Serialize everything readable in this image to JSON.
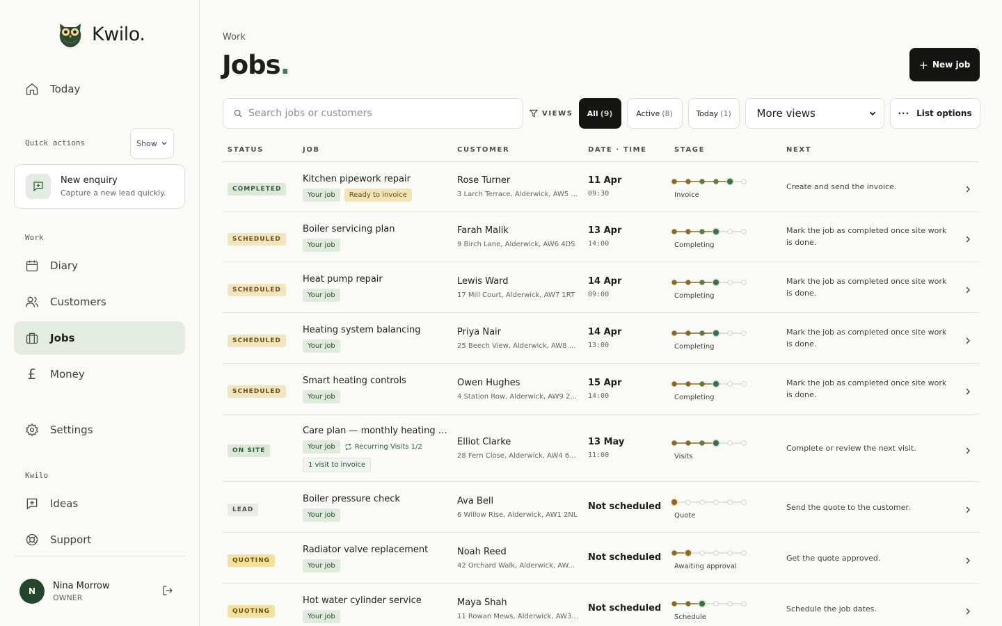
{
  "brand": {
    "name": "Kwilo."
  },
  "sidebar": {
    "today": "Today",
    "quick_actions_label": "Quick actions",
    "show_label": "Show",
    "new_enquiry": {
      "title": "New enquiry",
      "subtitle": "Capture a new lead quickly."
    },
    "work_label": "Work",
    "diary": "Diary",
    "customers": "Customers",
    "jobs": "Jobs",
    "money": "Money",
    "settings": "Settings",
    "kwilo_label": "Kwilo",
    "ideas": "Ideas",
    "support": "Support",
    "user": {
      "initial": "N",
      "name": "Nina Morrow",
      "role": "OWNER"
    }
  },
  "header": {
    "breadcrumb": "Work",
    "title": "Jobs",
    "new_job": "New job"
  },
  "toolbar": {
    "search_placeholder": "Search jobs or customers",
    "views_label": "VIEWS",
    "chips": [
      {
        "label": "All",
        "count": "(9)"
      },
      {
        "label": "Active",
        "count": "(8)"
      },
      {
        "label": "Today",
        "count": "(1)"
      }
    ],
    "more_views": "More views",
    "list_options": "List options"
  },
  "table": {
    "headers": {
      "status": "STATUS",
      "job": "JOB",
      "customer": "CUSTOMER",
      "datetime": "DATE · TIME",
      "stage": "STAGE",
      "next": "NEXT"
    },
    "rows": [
      {
        "status": "COMPLETED",
        "status_kind": "completed",
        "job": "Kitchen pipework repair",
        "tags": [
          "Your job",
          "Ready to invoice"
        ],
        "customer": "Rose Turner",
        "address": "3 Larch Terrace, Alderwick, AW5 ...",
        "date": "11 Apr",
        "time": "09:30",
        "stage": "Invoice",
        "stage_step": 5,
        "next": "Create and send the invoice."
      },
      {
        "status": "SCHEDULED",
        "status_kind": "scheduled",
        "job": "Boiler servicing plan",
        "tags": [
          "Your job"
        ],
        "customer": "Farah Malik",
        "address": "9 Birch Lane, Alderwick, AW6 4DS",
        "date": "13 Apr",
        "time": "14:00",
        "stage": "Completing",
        "stage_step": 4,
        "next": "Mark the job as completed once site work is done."
      },
      {
        "status": "SCHEDULED",
        "status_kind": "scheduled",
        "job": "Heat pump repair",
        "tags": [
          "Your job"
        ],
        "customer": "Lewis Ward",
        "address": "17 Mill Court, Alderwick, AW7 1RT",
        "date": "14 Apr",
        "time": "09:00",
        "stage": "Completing",
        "stage_step": 4,
        "next": "Mark the job as completed once site work is done."
      },
      {
        "status": "SCHEDULED",
        "status_kind": "scheduled",
        "job": "Heating system balancing",
        "tags": [
          "Your job"
        ],
        "customer": "Priya Nair",
        "address": "25 Beech View, Alderwick, AW8 ...",
        "date": "14 Apr",
        "time": "13:00",
        "stage": "Completing",
        "stage_step": 4,
        "next": "Mark the job as completed once site work is done."
      },
      {
        "status": "SCHEDULED",
        "status_kind": "scheduled",
        "job": "Smart heating controls",
        "tags": [
          "Your job"
        ],
        "customer": "Owen Hughes",
        "address": "4 Station Row, Alderwick, AW9 2...",
        "date": "15 Apr",
        "time": "14:00",
        "stage": "Completing",
        "stage_step": 4,
        "next": "Mark the job as completed once site work is done."
      },
      {
        "status": "ON SITE",
        "status_kind": "onsite",
        "job": "Care plan — monthly heating c...",
        "tags": [
          "Your job"
        ],
        "recurring": "Recurring Visits 1/2",
        "extra_tag": "1 visit to invoice",
        "customer": "Elliot Clarke",
        "address": "28 Fern Close, Alderwick, AW4 6...",
        "date": "13 May",
        "time": "11:00",
        "stage": "Visits",
        "stage_step": 4,
        "next": "Complete or review the next visit."
      },
      {
        "status": "LEAD",
        "status_kind": "lead",
        "job": "Boiler pressure check",
        "tags": [
          "Your job"
        ],
        "customer": "Ava Bell",
        "address": "6 Willow Rise, Alderwick, AW1 2NL",
        "date": "Not scheduled",
        "time": "",
        "stage": "Quote",
        "stage_step": 1,
        "next": "Send the quote to the customer."
      },
      {
        "status": "QUOTING",
        "status_kind": "quoting",
        "job": "Radiator valve replacement",
        "tags": [
          "Your job"
        ],
        "customer": "Noah Reed",
        "address": "42 Orchard Walk, Alderwick, AW...",
        "date": "Not scheduled",
        "time": "",
        "stage": "Awaiting approval",
        "stage_step": 2,
        "next": "Get the quote approved."
      },
      {
        "status": "QUOTING",
        "status_kind": "quoting",
        "job": "Hot water cylinder service",
        "tags": [
          "Your job"
        ],
        "customer": "Maya Shah",
        "address": "11 Rowan Mews, Alderwick, AW3 ...",
        "date": "Not scheduled",
        "time": "",
        "stage": "Schedule",
        "stage_step": 3,
        "next": "Schedule the job dates."
      }
    ]
  },
  "colors": {
    "accent": "#3e7f52",
    "dark": "#141513",
    "active_nav": "#e4ece1",
    "stage_done": "#8a6a22",
    "stage_mid": "#5d7d3c",
    "stage_current": "#3e6e4e"
  }
}
